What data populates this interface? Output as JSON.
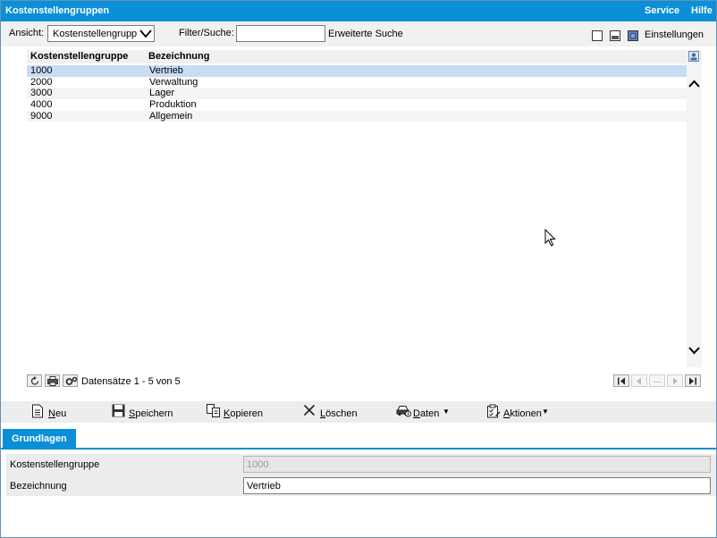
{
  "titlebar": {
    "title": "Kostenstellengruppen",
    "service": "Service",
    "hilfe": "Hilfe"
  },
  "toolbar": {
    "ansicht_label": "Ansicht:",
    "ansicht_value": "Kostenstellengrupp",
    "filter_label": "Filter/Suche:",
    "search_value": "",
    "erweiterte_suche": "Erweiterte Suche",
    "einstellungen": "Einstellungen"
  },
  "grid": {
    "columns": [
      "Kostenstellengruppe",
      "Bezeichnung"
    ],
    "rows": [
      {
        "code": "1000",
        "name": "Vertrieb",
        "selected": true
      },
      {
        "code": "2000",
        "name": "Verwaltung"
      },
      {
        "code": "3000",
        "name": "Lager"
      },
      {
        "code": "4000",
        "name": "Produktion"
      },
      {
        "code": "9000",
        "name": "Allgemein"
      }
    ]
  },
  "pager": {
    "records": "Datensätze 1 - 5 von 5",
    "ellipsis": "..."
  },
  "actions": {
    "neu": "Neu",
    "speichern": "Speichern",
    "kopieren": "Kopieren",
    "loeschen": "Löschen",
    "daten": "Daten",
    "aktionen": "Aktionen"
  },
  "tabs": {
    "grundlagen": "Grundlagen"
  },
  "form": {
    "kostenstellengruppe_label": "Kostenstellengruppe",
    "kostenstellengruppe_value": "1000",
    "bezeichnung_label": "Bezeichnung",
    "bezeichnung_value": "Vertrieb"
  },
  "colors": {
    "accent": "#0a8fd8",
    "selection": "#c8dcf4"
  }
}
